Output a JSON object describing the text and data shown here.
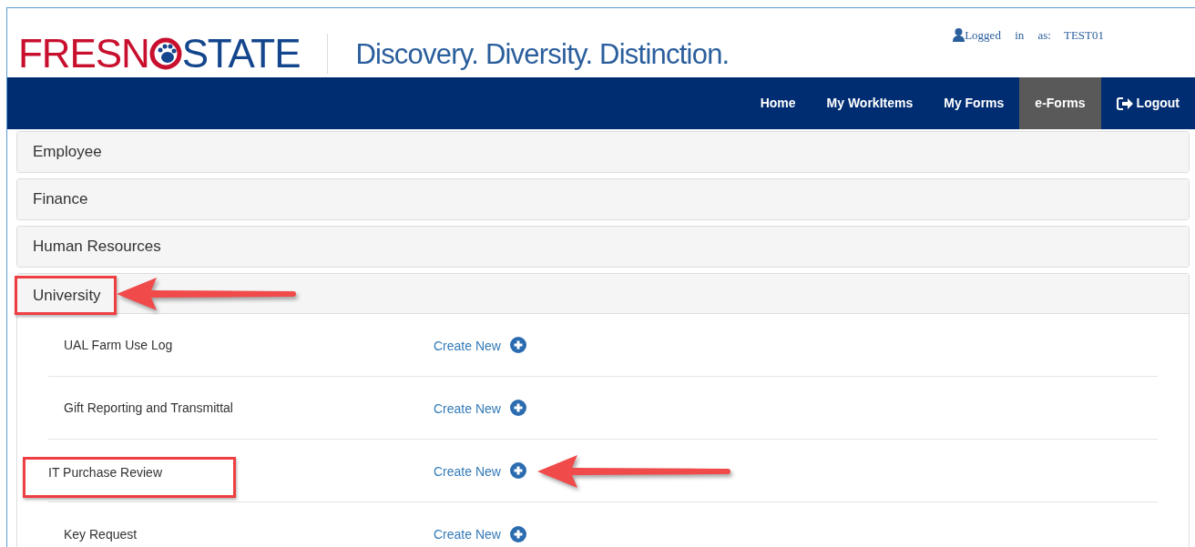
{
  "logo": {
    "left": "FRESN",
    "right": "STATE"
  },
  "tagline": "Discovery. Diversity. Distinction.",
  "user": {
    "label": "Logged in as:",
    "name": "TEST01"
  },
  "nav": [
    {
      "label": "Home",
      "selected": false,
      "kind": "link"
    },
    {
      "label": "My WorkItems",
      "selected": false,
      "kind": "link"
    },
    {
      "label": "My Forms",
      "selected": false,
      "kind": "link"
    },
    {
      "label": "e-Forms",
      "selected": true,
      "kind": "link"
    },
    {
      "label": "Logout",
      "selected": false,
      "kind": "logout"
    }
  ],
  "sections": [
    {
      "title": "Employee",
      "expanded": false,
      "highlighted": false,
      "arrow": false
    },
    {
      "title": "Finance",
      "expanded": false,
      "highlighted": false,
      "arrow": false
    },
    {
      "title": "Human Resources",
      "expanded": false,
      "highlighted": false,
      "arrow": false
    },
    {
      "title": "University",
      "expanded": true,
      "highlighted": true,
      "arrow": true,
      "forms": [
        {
          "name": "UAL Farm Use Log",
          "action": "Create New",
          "highlighted": false,
          "arrow": false
        },
        {
          "name": "Gift Reporting and Transmittal",
          "action": "Create New",
          "highlighted": false,
          "arrow": false
        },
        {
          "name": "IT Purchase Review",
          "action": "Create New",
          "highlighted": true,
          "arrow": true
        },
        {
          "name": "Key Request",
          "action": "Create New",
          "highlighted": false,
          "arrow": false
        }
      ]
    }
  ]
}
